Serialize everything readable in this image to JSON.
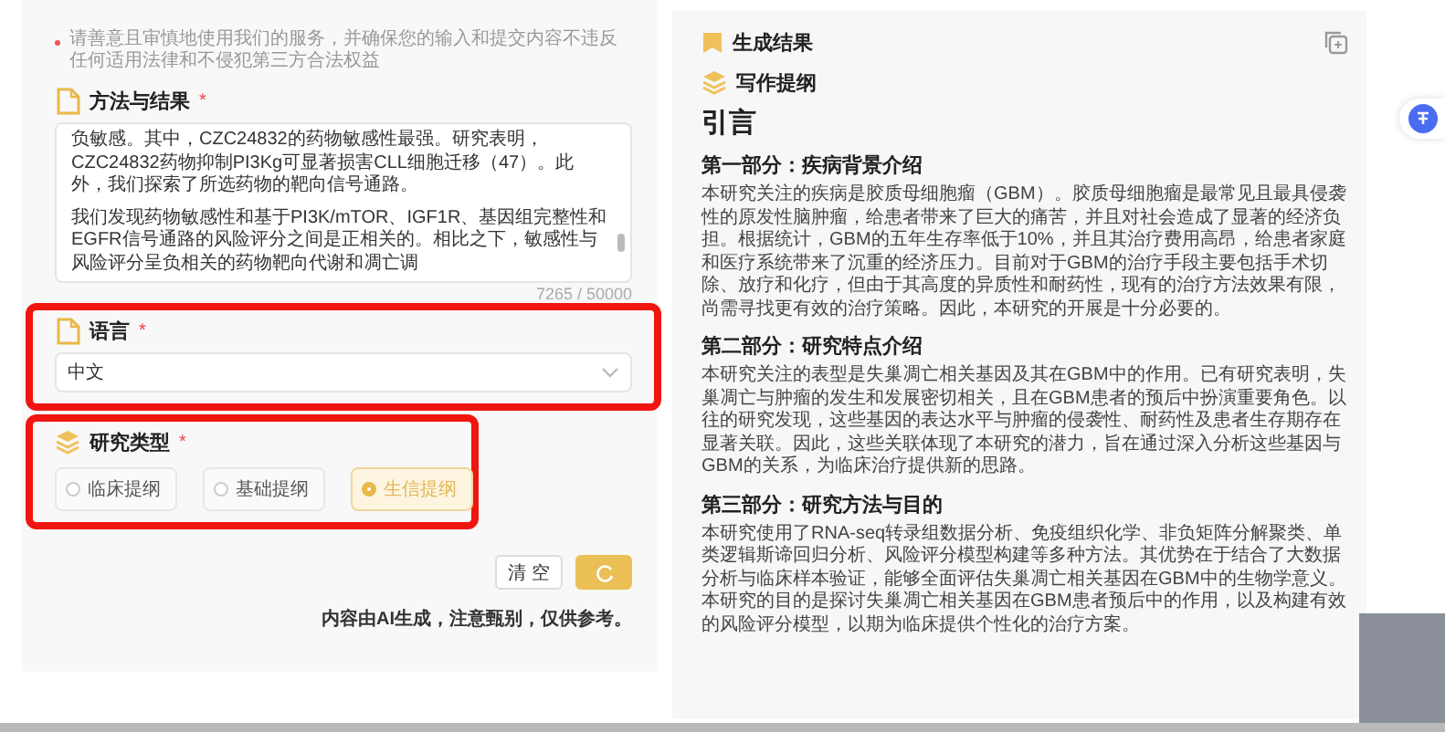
{
  "notice": "请善意且审慎地使用我们的服务，并确保您的输入和提交内容不违反任何适用法律和不侵犯第三方合法权益",
  "method_section": {
    "title": "方法与结果",
    "required_mark": "*",
    "content": [
      "负敏感。其中，CZC24832的药物敏感性最强。研究表明，CZC24832药物抑制PI3Kg可显著损害CLL细胞迁移（47）。此外，我们探索了所选药物的靶向信号通路。",
      "我们发现药物敏感性和基于PI3K/mTOR、IGF1R、基因组完整性和EGFR信号通路的风险评分之间是正相关的。相比之下，敏感性与风险评分呈负相关的药物靶向代谢和凋亡调"
    ],
    "counter": "7265 / 50000"
  },
  "language_section": {
    "title": "语言",
    "required_mark": "*",
    "value": "中文",
    "highlighted": true
  },
  "research_type_section": {
    "title": "研究类型",
    "required_mark": "*",
    "highlighted": true,
    "options": [
      {
        "label": "临床提纲",
        "selected": false
      },
      {
        "label": "基础提纲",
        "selected": false
      },
      {
        "label": "生信提纲",
        "selected": true
      }
    ]
  },
  "buttons": [
    {
      "kind": "text",
      "label": "清 空"
    },
    {
      "kind": "refresh"
    }
  ],
  "disclaimer": "内容由AI生成，注意甄别，仅供参考。",
  "result_panel": {
    "title": "生成结果",
    "subtitle": "写作提纲",
    "heading": "引言",
    "sections": [
      {
        "title": "第一部分：疾病背景介绍",
        "body": "本研究关注的疾病是胶质母细胞瘤（GBM）。胶质母细胞瘤是最常见且最具侵袭性的原发性脑肿瘤，给患者带来了巨大的痛苦，并且对社会造成了显著的经济负担。根据统计，GBM的五年生存率低于10%，并且其治疗费用高昂，给患者家庭和医疗系统带来了沉重的经济压力。目前对于GBM的治疗手段主要包括手术切除、放疗和化疗，但由于其高度的异质性和耐药性，现有的治疗方法效果有限，尚需寻找更有效的治疗策略。因此，本研究的开展是十分必要的。"
      },
      {
        "title": "第二部分：研究特点介绍",
        "body": "本研究关注的表型是失巢凋亡相关基因及其在GBM中的作用。已有研究表明，失巢凋亡与肿瘤的发生和发展密切相关，且在GBM患者的预后中扮演重要角色。以往的研究发现，这些基因的表达水平与肿瘤的侵袭性、耐药性及患者生存期存在显著关联。因此，这些关联体现了本研究的潜力，旨在通过深入分析这些基因与GBM的关系，为临床治疗提供新的思路。"
      },
      {
        "title": "第三部分：研究方法与目的",
        "body": "本研究使用了RNA-seq转录组数据分析、免疫组织化学、非负矩阵分解聚类、单类逻辑斯谛回归分析、风险评分模型构建等多种方法。其优势在于结合了大数据分析与临床样本验证，能够全面评估失巢凋亡相关基因在GBM中的生物学意义。本研究的目的是探讨失巢凋亡相关基因在GBM患者预后中的作用，以及构建有效的风险评分模型，以期为临床提供个性化的治疗方案。"
      }
    ]
  }
}
